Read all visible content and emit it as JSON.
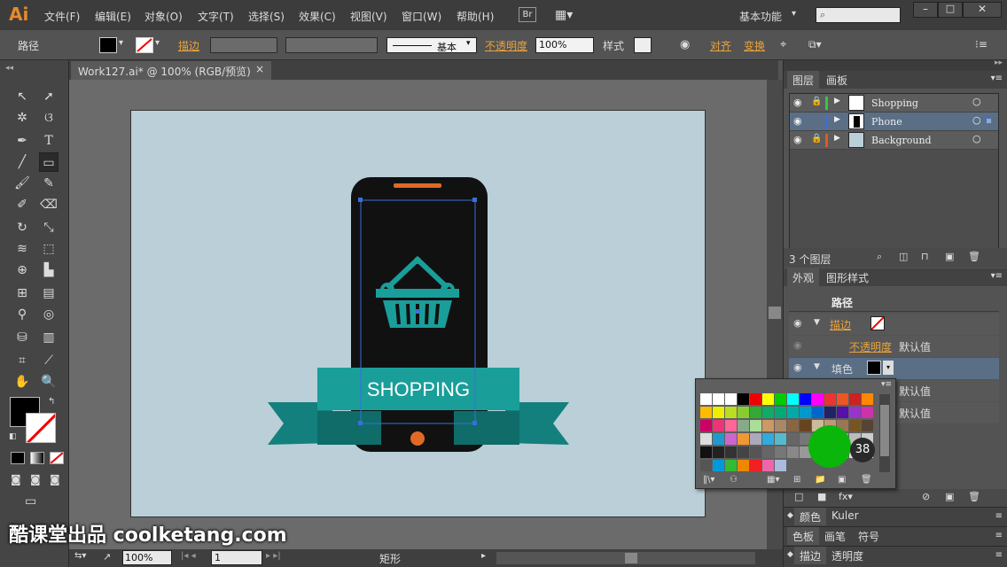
{
  "app": {
    "logo": "Ai",
    "workspace": "基本功能",
    "bridge": "Br"
  },
  "menu": [
    "文件(F)",
    "编辑(E)",
    "对象(O)",
    "文字(T)",
    "选择(S)",
    "效果(C)",
    "视图(V)",
    "窗口(W)",
    "帮助(H)"
  ],
  "control": {
    "selection_label": "路径",
    "stroke_label": "描边",
    "stroke_style": "基本",
    "opacity_label": "不透明度",
    "opacity_value": "100%",
    "style_label": "样式",
    "align_label": "对齐",
    "transform_label": "变换"
  },
  "document": {
    "tab_title": "Work127.ai* @ 100% (RGB/预览)",
    "close": "×"
  },
  "artwork": {
    "ribbon_text": "SHOPPING"
  },
  "layers": {
    "tabs": [
      "图层",
      "画板"
    ],
    "items": [
      {
        "name": "Shopping",
        "color": "#2ecc40"
      },
      {
        "name": "Phone",
        "color": "#3b6fe0"
      },
      {
        "name": "Background",
        "color": "#e0572b"
      }
    ],
    "count": "3 个图层"
  },
  "appearance": {
    "tabs": [
      "外观",
      "图形样式"
    ],
    "title": "路径",
    "stroke_label": "描边",
    "opacity_label": "不透明度",
    "opacity_value": "默认值",
    "fill_label": "填色",
    "opacity_value_2": "默认值",
    "opacity_value_3": "默认值"
  },
  "bottom_panels": {
    "row1": [
      "颜色",
      "Kuler"
    ],
    "row2": [
      "色板",
      "画笔",
      "符号"
    ],
    "row3": [
      "描边",
      "透明度"
    ]
  },
  "status": {
    "zoom": "100%",
    "artboard_num": "1",
    "tool_name": "矩形"
  },
  "swatch_badge": "38",
  "watermark": "酷课堂出品 coolketang.com",
  "colors": {
    "accent_orange": "#e58a2b",
    "teal": "#1a9e9a",
    "phone": "#111111",
    "artboard": "#bacfd8"
  }
}
